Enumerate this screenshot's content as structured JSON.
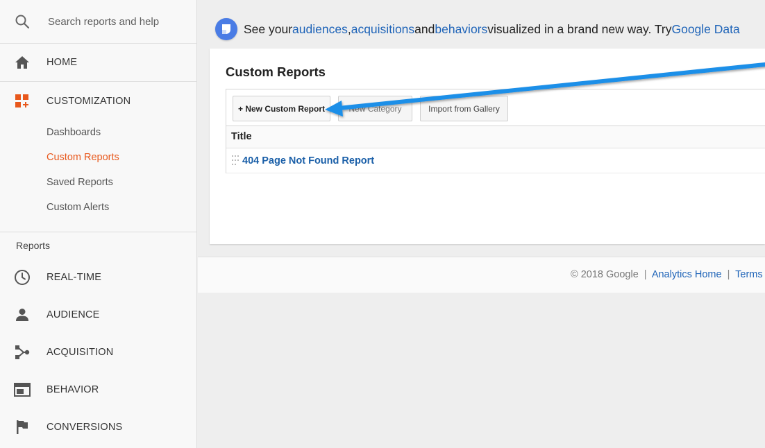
{
  "search": {
    "placeholder": "Search reports and help"
  },
  "sidebar": {
    "home": {
      "label": "HOME",
      "icon": "home-icon"
    },
    "customization": {
      "label": "CUSTOMIZATION",
      "icon": "customization-icon",
      "items": [
        {
          "label": "Dashboards"
        },
        {
          "label": "Custom Reports",
          "active": true
        },
        {
          "label": "Saved Reports"
        },
        {
          "label": "Custom Alerts"
        }
      ]
    },
    "reports_heading": "Reports",
    "reports": [
      {
        "label": "REAL-TIME",
        "icon": "clock-icon"
      },
      {
        "label": "AUDIENCE",
        "icon": "person-icon"
      },
      {
        "label": "ACQUISITION",
        "icon": "acquisition-icon"
      },
      {
        "label": "BEHAVIOR",
        "icon": "behavior-icon"
      },
      {
        "label": "CONVERSIONS",
        "icon": "flag-icon"
      }
    ]
  },
  "banner": {
    "prefix": "See your ",
    "link1": "audiences",
    "sep1": ", ",
    "link2": "acquisitions",
    "sep2": " and ",
    "link3": "behaviors",
    "middle": " visualized in a brand new way. Try ",
    "link4": "Google Data"
  },
  "card": {
    "title": "Custom Reports",
    "buttons": {
      "new_report": "+ New Custom Report",
      "new_category": "New Category",
      "import_gallery": "Import from Gallery"
    },
    "table_header": "Title",
    "rows": [
      {
        "title": "404 Page Not Found Report"
      }
    ]
  },
  "footer": {
    "copyright": "© 2018 Google",
    "sep": "|",
    "link1": "Analytics Home",
    "link2": "Terms of"
  },
  "colors": {
    "accent_orange": "#e8581c",
    "link_blue": "#1f64b8",
    "arrow_blue": "#1e8fe8"
  }
}
